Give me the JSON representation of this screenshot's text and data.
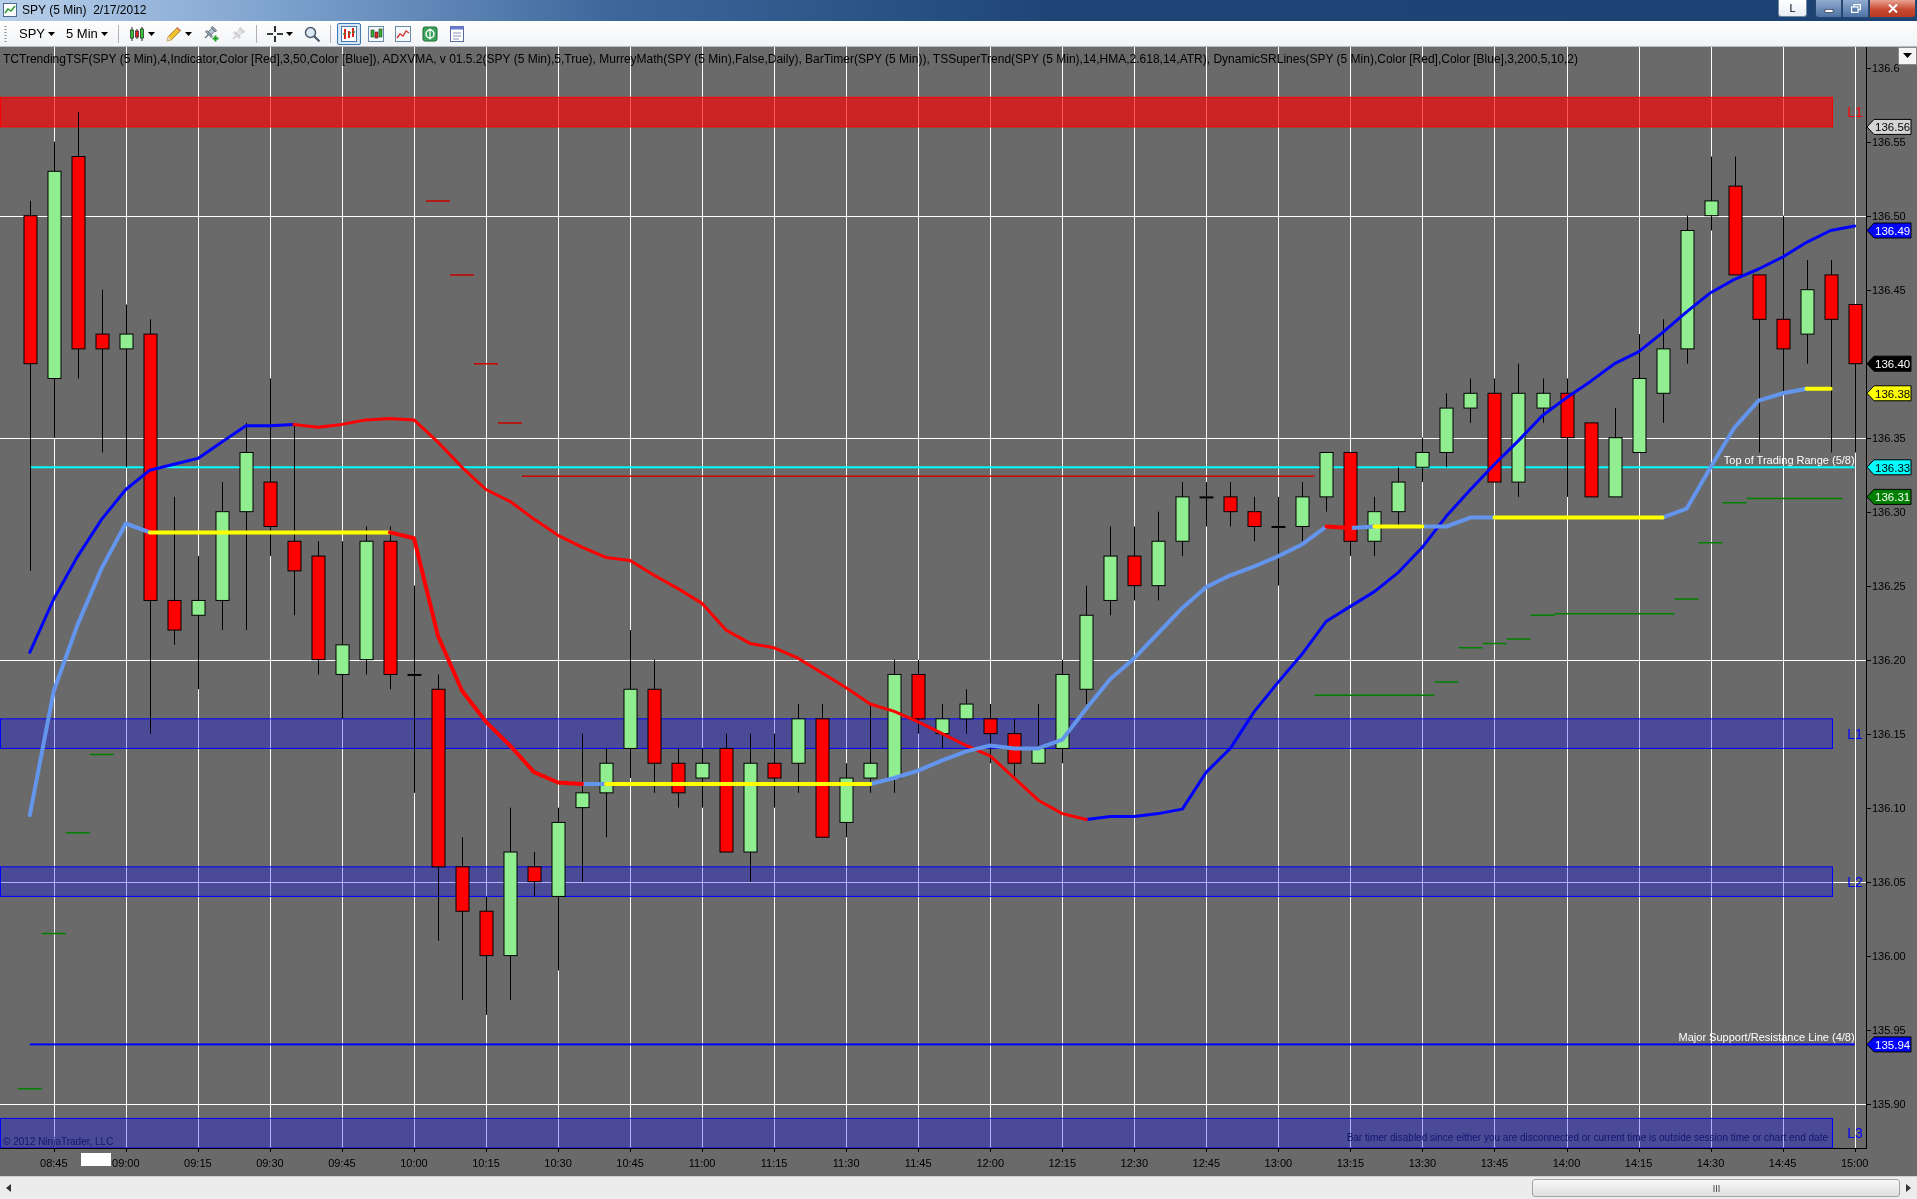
{
  "window": {
    "title": "SPY (5 Min)  2/17/2012",
    "link_label": "L"
  },
  "toolbar": {
    "instrument": "SPY",
    "interval": "5 Min",
    "tools": [
      {
        "disabled": false
      },
      {
        "disabled": false
      },
      {
        "disabled": false
      },
      {
        "disabled": true
      },
      {
        "disabled": false
      },
      {
        "disabled": false
      }
    ],
    "view_buttons": [
      {
        "selected": true
      },
      {
        "selected": false
      },
      {
        "selected": false
      },
      {
        "selected": false
      },
      {
        "selected": false
      }
    ]
  },
  "chart": {
    "indicator_legend": "TCTrendingTSF(SPY (5 Min),4,Indicator,Color [Red],3,50,Color [Blue]), ADXVMA, v 01.5.2(SPY (5 Min),5,True), MurreyMath(SPY (5 Min),False,Daily), BarTimer(SPY (5 Min)), TSSuperTrend(SPY (5 Min),14,HMA,2.618,14,ATR), DynamicSRLines(SPY (5 Min),Color [Red],Color [Blue],3,200,5,10,2)",
    "chart_data": [
      {
        "type": "candlestick",
        "x": [
          8.6667,
          8.75,
          8.8333,
          8.9167,
          9,
          9.0833,
          9.1667,
          9.25,
          9.3333,
          9.4167,
          9.5,
          9.5833,
          9.6667,
          9.75,
          9.8333,
          9.9167,
          10,
          10.0833,
          10.1667,
          10.25,
          10.3333,
          10.4167,
          10.5,
          10.5833,
          10.6667,
          10.75,
          10.8333,
          10.9167,
          11,
          11.0833,
          11.1667,
          11.25,
          11.3333,
          11.4167,
          11.5,
          11.5833,
          11.6667,
          11.75,
          11.8333,
          11.9167,
          12,
          12.0833,
          12.1667,
          12.25,
          12.3333,
          12.4167,
          12.5,
          12.5833,
          12.6667,
          12.75,
          12.8333,
          12.9167,
          13,
          13.0833,
          13.1667,
          13.25,
          13.3333,
          13.4167,
          13.5,
          13.5833,
          13.6667,
          13.75,
          13.8333,
          13.9167,
          14,
          14.0833,
          14.1667,
          14.25,
          14.3333,
          14.4167,
          14.5,
          14.5833,
          14.6667,
          14.75,
          14.8333,
          14.9167,
          15
        ],
        "ohlc": [
          [
            136.5,
            136.51,
            136.26,
            136.4
          ],
          [
            136.39,
            136.55,
            136.35,
            136.53
          ],
          [
            136.54,
            136.57,
            136.39,
            136.41
          ],
          [
            136.42,
            136.45,
            136.34,
            136.41
          ],
          [
            136.41,
            136.44,
            136.33,
            136.42
          ],
          [
            136.42,
            136.43,
            136.15,
            136.24
          ],
          [
            136.24,
            136.31,
            136.21,
            136.22
          ],
          [
            136.23,
            136.27,
            136.18,
            136.24
          ],
          [
            136.24,
            136.32,
            136.22,
            136.3
          ],
          [
            136.3,
            136.36,
            136.22,
            136.34
          ],
          [
            136.32,
            136.39,
            136.27,
            136.29
          ],
          [
            136.28,
            136.36,
            136.23,
            136.26
          ],
          [
            136.27,
            136.28,
            136.19,
            136.2
          ],
          [
            136.19,
            136.28,
            136.16,
            136.21
          ],
          [
            136.2,
            136.29,
            136.19,
            136.28
          ],
          [
            136.28,
            136.29,
            136.18,
            136.19
          ],
          [
            136.19,
            136.25,
            136.11,
            136.19
          ],
          [
            136.18,
            136.19,
            136.01,
            136.06
          ],
          [
            136.06,
            136.08,
            135.97,
            136.03
          ],
          [
            136.03,
            136.04,
            135.96,
            136.0
          ],
          [
            136.0,
            136.1,
            135.97,
            136.07
          ],
          [
            136.06,
            136.07,
            136.04,
            136.05
          ],
          [
            136.04,
            136.1,
            135.99,
            136.09
          ],
          [
            136.1,
            136.15,
            136.05,
            136.11
          ],
          [
            136.11,
            136.14,
            136.08,
            136.13
          ],
          [
            136.14,
            136.22,
            136.12,
            136.18
          ],
          [
            136.18,
            136.2,
            136.11,
            136.13
          ],
          [
            136.13,
            136.14,
            136.1,
            136.11
          ],
          [
            136.12,
            136.14,
            136.1,
            136.13
          ],
          [
            136.14,
            136.15,
            136.07,
            136.07
          ],
          [
            136.07,
            136.15,
            136.05,
            136.13
          ],
          [
            136.13,
            136.15,
            136.1,
            136.12
          ],
          [
            136.13,
            136.17,
            136.11,
            136.16
          ],
          [
            136.16,
            136.17,
            136.08,
            136.08
          ],
          [
            136.09,
            136.13,
            136.08,
            136.12
          ],
          [
            136.12,
            136.17,
            136.11,
            136.13
          ],
          [
            136.12,
            136.2,
            136.11,
            136.19
          ],
          [
            136.19,
            136.2,
            136.15,
            136.16
          ],
          [
            136.15,
            136.17,
            136.14,
            136.16
          ],
          [
            136.16,
            136.18,
            136.15,
            136.17
          ],
          [
            136.16,
            136.17,
            136.13,
            136.15
          ],
          [
            136.15,
            136.16,
            136.12,
            136.13
          ],
          [
            136.13,
            136.17,
            136.13,
            136.14
          ],
          [
            136.14,
            136.2,
            136.13,
            136.19
          ],
          [
            136.18,
            136.25,
            136.17,
            136.23
          ],
          [
            136.24,
            136.29,
            136.23,
            136.27
          ],
          [
            136.27,
            136.29,
            136.24,
            136.25
          ],
          [
            136.25,
            136.3,
            136.24,
            136.28
          ],
          [
            136.28,
            136.32,
            136.27,
            136.31
          ],
          [
            136.31,
            136.32,
            136.29,
            136.31
          ],
          [
            136.31,
            136.32,
            136.29,
            136.3
          ],
          [
            136.3,
            136.31,
            136.28,
            136.29
          ],
          [
            136.29,
            136.31,
            136.25,
            136.29
          ],
          [
            136.29,
            136.32,
            136.28,
            136.31
          ],
          [
            136.31,
            136.34,
            136.3,
            136.34
          ],
          [
            136.34,
            136.34,
            136.27,
            136.28
          ],
          [
            136.28,
            136.31,
            136.27,
            136.3
          ],
          [
            136.3,
            136.33,
            136.29,
            136.32
          ],
          [
            136.33,
            136.35,
            136.32,
            136.34
          ],
          [
            136.34,
            136.38,
            136.33,
            136.37
          ],
          [
            136.37,
            136.39,
            136.36,
            136.38
          ],
          [
            136.38,
            136.39,
            136.32,
            136.32
          ],
          [
            136.32,
            136.4,
            136.31,
            136.38
          ],
          [
            136.37,
            136.39,
            136.36,
            136.38
          ],
          [
            136.38,
            136.39,
            136.31,
            136.35
          ],
          [
            136.36,
            136.36,
            136.31,
            136.31
          ],
          [
            136.31,
            136.37,
            136.31,
            136.35
          ],
          [
            136.34,
            136.42,
            136.34,
            136.39
          ],
          [
            136.38,
            136.43,
            136.36,
            136.41
          ],
          [
            136.41,
            136.5,
            136.4,
            136.49
          ],
          [
            136.5,
            136.54,
            136.49,
            136.51
          ],
          [
            136.52,
            136.54,
            136.46,
            136.46
          ],
          [
            136.46,
            136.46,
            136.34,
            136.43
          ],
          [
            136.43,
            136.5,
            136.38,
            136.41
          ],
          [
            136.42,
            136.47,
            136.4,
            136.45
          ],
          [
            136.46,
            136.47,
            136.34,
            136.43
          ],
          [
            136.44,
            136.44,
            136.34,
            136.4
          ]
        ],
        "series": [
          {
            "type": "line",
            "color": "#0000ff",
            "values": [
              136.205,
              136.241,
              136.27,
              136.295,
              136.315,
              136.328,
              136.332,
              136.336,
              136.347,
              136.358,
              136.358,
              136.359,
              null,
              null,
              null,
              null,
              null,
              null,
              null,
              null,
              null,
              null,
              null,
              null,
              null,
              null,
              null,
              null,
              null,
              null,
              null,
              null,
              null,
              null,
              null,
              null,
              null,
              null,
              null,
              null,
              null,
              null,
              null,
              null,
              136.092,
              136.094,
              136.094,
              136.096,
              136.099,
              136.124,
              136.14,
              136.165,
              136.185,
              136.204,
              136.226,
              136.236,
              136.246,
              136.259,
              136.276,
              136.297,
              136.315,
              136.332,
              136.348,
              136.365,
              136.377,
              136.388,
              136.4,
              136.408,
              136.421,
              136.435,
              136.448,
              136.457,
              136.464,
              136.472,
              136.482,
              136.49,
              136.493
            ]
          },
          {
            "type": "line",
            "color": "#ff0000",
            "values": [
              null,
              null,
              null,
              null,
              null,
              null,
              null,
              null,
              null,
              null,
              null,
              136.359,
              136.357,
              136.359,
              136.362,
              136.363,
              136.362,
              136.347,
              136.33,
              136.315,
              136.307,
              136.295,
              136.284,
              136.276,
              136.269,
              136.267,
              136.257,
              136.248,
              136.238,
              136.22,
              136.211,
              136.208,
              136.201,
              136.191,
              136.181,
              136.17,
              136.165,
              136.158,
              136.15,
              136.142,
              136.135,
              136.12,
              136.105,
              136.096,
              136.092,
              null,
              null,
              null,
              null,
              null,
              null,
              null,
              null,
              null,
              null,
              null,
              null,
              null,
              null,
              null,
              null,
              null,
              null,
              null,
              null,
              null,
              null,
              null,
              null,
              null,
              null,
              null,
              null,
              null,
              null,
              null,
              null
            ]
          },
          {
            "type": "line",
            "color": "#6495ed",
            "values": [
              136.095,
              136.179,
              136.224,
              136.262,
              136.292,
              136.286,
              null,
              null,
              null,
              null,
              null,
              null,
              null,
              null,
              null,
              null,
              null,
              null,
              null,
              null,
              null,
              null,
              null,
              136.116,
              136.116,
              null,
              null,
              null,
              null,
              null,
              null,
              null,
              null,
              null,
              null,
              136.116,
              136.12,
              136.125,
              136.132,
              136.138,
              136.142,
              136.14,
              136.14,
              136.146,
              136.167,
              136.187,
              136.201,
              136.218,
              136.235,
              136.249,
              136.257,
              136.263,
              136.27,
              136.278,
              136.29,
              null,
              null,
              null,
              null,
              null,
              null,
              null,
              null,
              null,
              null,
              null,
              null,
              null,
              null,
              null,
              null,
              null,
              null,
              null,
              null,
              null,
              null
            ]
          },
          {
            "type": "line",
            "color": "#6495ed",
            "values": [
              null,
              null,
              null,
              null,
              null,
              null,
              null,
              null,
              null,
              null,
              null,
              null,
              null,
              null,
              null,
              null,
              null,
              null,
              null,
              null,
              null,
              null,
              null,
              null,
              null,
              null,
              null,
              null,
              null,
              null,
              null,
              null,
              null,
              null,
              null,
              null,
              null,
              null,
              null,
              null,
              null,
              null,
              null,
              null,
              null,
              null,
              null,
              null,
              null,
              null,
              null,
              null,
              null,
              null,
              null,
              136.289,
              136.29,
              null,
              136.29,
              136.29,
              136.296,
              136.296,
              null,
              null,
              null,
              null,
              null,
              null,
              136.296,
              136.302,
              136.33,
              136.357,
              136.375,
              136.38,
              136.383,
              null,
              null
            ]
          },
          {
            "type": "line",
            "color": "#ffff00",
            "values": [
              null,
              null,
              null,
              null,
              null,
              136.286,
              136.286,
              136.286,
              136.286,
              136.286,
              136.286,
              136.286,
              136.286,
              136.286,
              136.286,
              136.286,
              null,
              null,
              null,
              null,
              null,
              null,
              null,
              null,
              136.116,
              136.116,
              136.116,
              136.116,
              136.116,
              136.116,
              136.116,
              136.116,
              136.116,
              136.116,
              136.116,
              136.116,
              null,
              null,
              null,
              null,
              null,
              null,
              null,
              null,
              null,
              null,
              null,
              null,
              null,
              null,
              null,
              null,
              null,
              null,
              null,
              null,
              136.29,
              136.29,
              136.29,
              null,
              null,
              136.296,
              136.296,
              136.296,
              136.296,
              136.296,
              136.296,
              136.296,
              136.296,
              null,
              null,
              null,
              null,
              null,
              136.383,
              136.383,
              null
            ]
          },
          {
            "type": "line",
            "color": "#ff0000",
            "values": [
              null,
              null,
              null,
              null,
              null,
              null,
              null,
              null,
              null,
              null,
              null,
              null,
              null,
              null,
              null,
              136.286,
              136.282,
              136.216,
              136.179,
              136.158,
              136.142,
              136.124,
              136.117,
              136.116,
              null,
              null,
              null,
              null,
              null,
              null,
              null,
              null,
              null,
              null,
              null,
              null,
              null,
              null,
              null,
              null,
              null,
              null,
              null,
              null,
              null,
              null,
              null,
              null,
              null,
              null,
              null,
              null,
              null,
              null,
              136.29,
              136.289,
              null,
              null,
              null,
              null,
              null,
              null,
              null,
              null,
              null,
              null,
              null,
              null,
              null,
              null,
              null,
              null,
              null,
              null,
              null,
              null,
              null
            ]
          },
          {
            "type": "line",
            "color": "#cc0000",
            "x": [
              10.0417,
              10.125,
              null,
              10.125,
              10.2083,
              null,
              10.2083,
              10.2917,
              null,
              10.2917,
              10.375,
              null,
              10.375,
              13.125
            ],
            "values": [
              136.51,
              136.51,
              null,
              136.46,
              136.46,
              null,
              136.4,
              136.4,
              null,
              136.36,
              136.36,
              null,
              136.324,
              136.324
            ]
          },
          {
            "type": "line",
            "color": "#008000",
            "x": [
              8.625,
              8.7083,
              null,
              8.7083,
              8.7917,
              null,
              8.7917,
              8.875,
              null,
              8.875,
              8.9583,
              null,
              13.125,
              13.5417,
              null,
              13.5417,
              13.625,
              null,
              13.625,
              13.7083,
              null,
              13.7083,
              13.7917,
              null,
              13.7917,
              13.875,
              null,
              13.875,
              13.9583,
              null,
              13.9583,
              14.375,
              null,
              14.375,
              14.4583,
              null,
              14.4583,
              14.5417,
              null,
              14.5417,
              14.625,
              null,
              14.625,
              14.9583
            ],
            "values": [
              135.91,
              135.91,
              null,
              136.015,
              136.015,
              null,
              136.083,
              136.083,
              null,
              136.136,
              136.136,
              null,
              136.176,
              136.176,
              null,
              136.185,
              136.185,
              null,
              136.208,
              136.208,
              null,
              136.211,
              136.211,
              null,
              136.214,
              136.214,
              null,
              136.23,
              136.23,
              null,
              136.231,
              136.231,
              null,
              136.241,
              136.241,
              null,
              136.279,
              136.279,
              null,
              136.306,
              136.306,
              null,
              136.309,
              136.309
            ]
          }
        ],
        "xlim": [
          8.5633,
          15.0394
        ],
        "xticks": [
          {
            "value": 8.75,
            "label": "08:45"
          },
          {
            "value": 9,
            "label": "09:00"
          },
          {
            "value": 9.25,
            "label": "09:15"
          },
          {
            "value": 9.5,
            "label": "09:30"
          },
          {
            "value": 9.75,
            "label": "09:45"
          },
          {
            "value": 10,
            "label": "10:00"
          },
          {
            "value": 10.25,
            "label": "10:15"
          },
          {
            "value": 10.5,
            "label": "10:30"
          },
          {
            "value": 10.75,
            "label": "10:45"
          },
          {
            "value": 11,
            "label": "11:00"
          },
          {
            "value": 11.25,
            "label": "11:15"
          },
          {
            "value": 11.5,
            "label": "11:30"
          },
          {
            "value": 11.75,
            "label": "11:45"
          },
          {
            "value": 12,
            "label": "12:00"
          },
          {
            "value": 12.25,
            "label": "12:15"
          },
          {
            "value": 12.5,
            "label": "12:30"
          },
          {
            "value": 12.75,
            "label": "12:45"
          },
          {
            "value": 13,
            "label": "13:00"
          },
          {
            "value": 13.25,
            "label": "13:15"
          },
          {
            "value": 13.5,
            "label": "13:30"
          },
          {
            "value": 13.75,
            "label": "13:45"
          },
          {
            "value": 14,
            "label": "14:00"
          },
          {
            "value": 14.25,
            "label": "14:15"
          },
          {
            "value": 14.5,
            "label": "14:30"
          },
          {
            "value": 14.75,
            "label": "14:45"
          },
          {
            "value": 15,
            "label": "15:00"
          }
        ],
        "ylim": [
          135.87,
          136.614
        ],
        "yticks": [
          {
            "value": 136.6,
            "label": "136.6"
          },
          {
            "value": 136.55,
            "label": "136.55"
          },
          {
            "value": 136.5,
            "label": "136.50"
          },
          {
            "value": 136.45,
            "label": "136.45"
          },
          {
            "value": 136.35,
            "label": "136.35"
          },
          {
            "value": 136.3,
            "label": "136.30"
          },
          {
            "value": 136.25,
            "label": "136.25"
          },
          {
            "value": 136.2,
            "label": "136.20"
          },
          {
            "value": 136.15,
            "label": "136.15"
          },
          {
            "value": 136.1,
            "label": "136.10"
          },
          {
            "value": 136.05,
            "label": "136.05"
          },
          {
            "value": 136.0,
            "label": "136.00"
          },
          {
            "value": 135.95,
            "label": "135.95"
          },
          {
            "value": 135.9,
            "label": "135.90"
          }
        ],
        "grid": true,
        "bands": [
          {
            "axis": "y",
            "from": 136.56,
            "to": 136.58,
            "label": "L1",
            "color": "#ff0000"
          },
          {
            "axis": "y",
            "from": 136.14,
            "to": 136.16,
            "label": "L1",
            "color": "#0000ff"
          },
          {
            "axis": "y",
            "from": 136.04,
            "to": 136.06,
            "label": "L2",
            "color": "#0000ff"
          },
          {
            "axis": "y",
            "from": 135.87,
            "to": 135.89,
            "label": "L3",
            "color": "#0000ff"
          }
        ],
        "ref_lines": [
          {
            "axis": "y",
            "value": 136.33,
            "label": "Top of Trading Range (5/8)",
            "color": "#00ffff"
          },
          {
            "axis": "y",
            "value": 135.94,
            "label": "Major Support/Resistance Line (4/8)",
            "color": "#0000ff"
          }
        ]
      }
    ],
    "price_markers": [
      {
        "label": "136.56",
        "color": "#d4d4d4"
      },
      {
        "label": "136.49",
        "color": "#0000ff"
      },
      {
        "label": "136.40",
        "color": "#000000"
      },
      {
        "label": "136.38",
        "color": "#ffff00"
      },
      {
        "label": "136.33",
        "color": "#00ffff"
      },
      {
        "label": "136.31",
        "color": "#008000"
      },
      {
        "label": "135.94",
        "color": "#0000ff"
      }
    ],
    "copyright": "© 2012 NinjaTrader, LLC",
    "status_message": "Bar timer disabled since either you are disconnected or current time is outside session time or chart end date"
  }
}
